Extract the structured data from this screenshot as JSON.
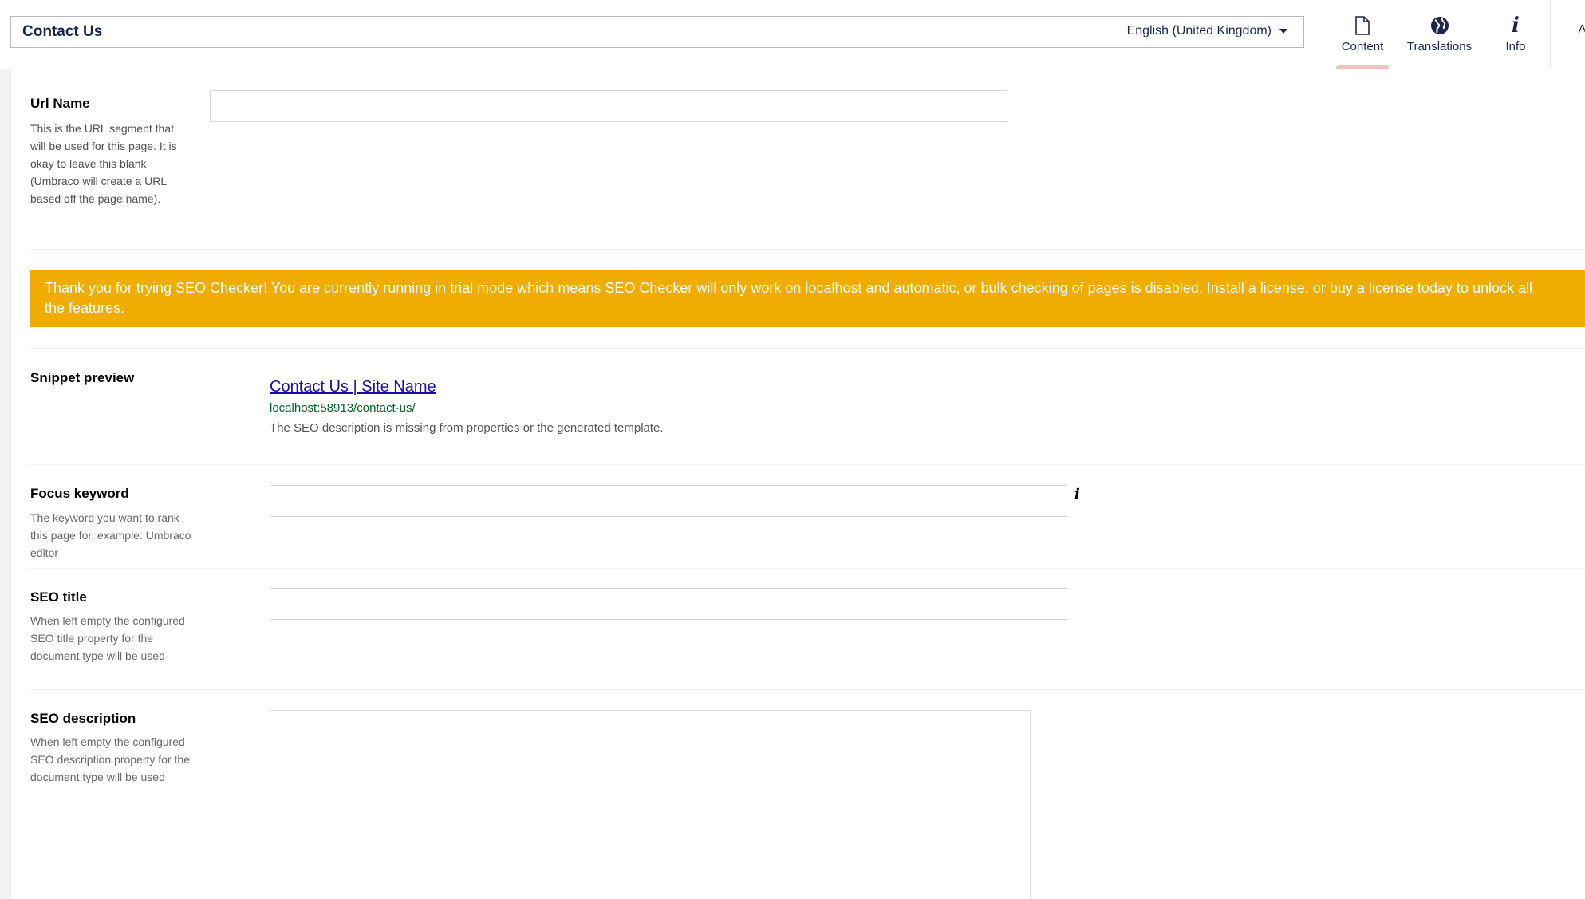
{
  "header": {
    "node_name": "Contact Us",
    "language": "English (United Kingdom)",
    "apps": [
      {
        "label": "Content",
        "icon": "document-icon"
      },
      {
        "label": "Translations",
        "icon": "globe-icon"
      },
      {
        "label": "Info",
        "icon": "info-icon"
      },
      {
        "label": "A"
      }
    ]
  },
  "url_name": {
    "label": "Url Name",
    "description": "This is the URL segment that will be used for this page. It is okay to leave this blank (Umbraco will create a URL based off the page name).",
    "value": ""
  },
  "banner": {
    "text_before": "Thank you for trying SEO Checker! You are currently running in trial mode which means SEO Checker will only work on localhost and automatic, or bulk checking of pages is disabled. ",
    "link1": "Install a license",
    "text_middle": ", or ",
    "link2": "buy a license",
    "text_after": " today to unlock all the features.",
    "color": "#f0ac00"
  },
  "snippet": {
    "label": "Snippet preview",
    "title": "Contact Us | Site Name",
    "url": "localhost:58913/contact-us/",
    "description": "The SEO description is missing from properties or the generated template."
  },
  "focus_keyword": {
    "label": "Focus keyword",
    "description": "The keyword you want to rank this page for, example: Umbraco editor",
    "value": "",
    "info_glyph": "i"
  },
  "seo_title": {
    "label": "SEO title",
    "description": "When left empty the configured SEO title property for the document type will be used",
    "value": ""
  },
  "seo_description": {
    "label": "SEO description",
    "description": "When left empty the configured SEO description property for the document type will be used",
    "value": ""
  }
}
